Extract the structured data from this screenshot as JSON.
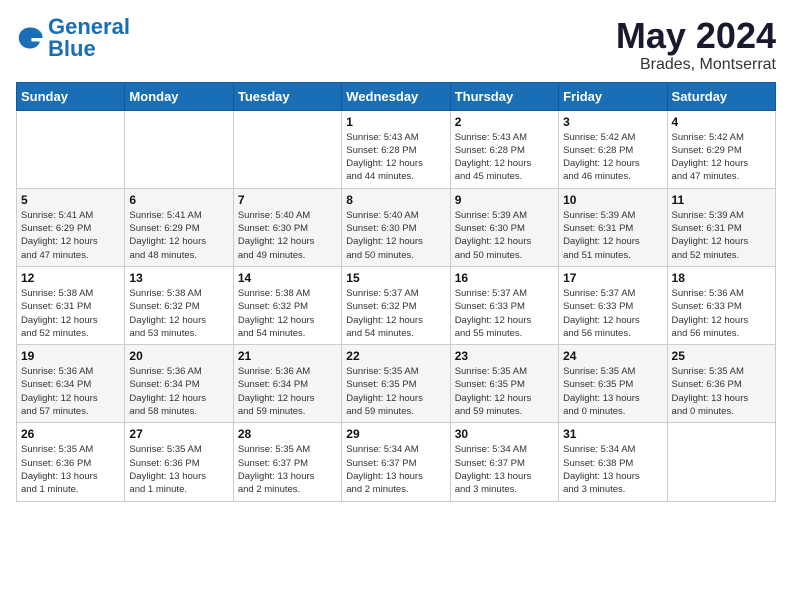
{
  "logo": {
    "line1": "General",
    "line2": "Blue"
  },
  "title": {
    "month": "May 2024",
    "location": "Brades, Montserrat"
  },
  "weekdays": [
    "Sunday",
    "Monday",
    "Tuesday",
    "Wednesday",
    "Thursday",
    "Friday",
    "Saturday"
  ],
  "weeks": [
    [
      {
        "day": "",
        "info": ""
      },
      {
        "day": "",
        "info": ""
      },
      {
        "day": "",
        "info": ""
      },
      {
        "day": "1",
        "info": "Sunrise: 5:43 AM\nSunset: 6:28 PM\nDaylight: 12 hours\nand 44 minutes."
      },
      {
        "day": "2",
        "info": "Sunrise: 5:43 AM\nSunset: 6:28 PM\nDaylight: 12 hours\nand 45 minutes."
      },
      {
        "day": "3",
        "info": "Sunrise: 5:42 AM\nSunset: 6:28 PM\nDaylight: 12 hours\nand 46 minutes."
      },
      {
        "day": "4",
        "info": "Sunrise: 5:42 AM\nSunset: 6:29 PM\nDaylight: 12 hours\nand 47 minutes."
      }
    ],
    [
      {
        "day": "5",
        "info": "Sunrise: 5:41 AM\nSunset: 6:29 PM\nDaylight: 12 hours\nand 47 minutes."
      },
      {
        "day": "6",
        "info": "Sunrise: 5:41 AM\nSunset: 6:29 PM\nDaylight: 12 hours\nand 48 minutes."
      },
      {
        "day": "7",
        "info": "Sunrise: 5:40 AM\nSunset: 6:30 PM\nDaylight: 12 hours\nand 49 minutes."
      },
      {
        "day": "8",
        "info": "Sunrise: 5:40 AM\nSunset: 6:30 PM\nDaylight: 12 hours\nand 50 minutes."
      },
      {
        "day": "9",
        "info": "Sunrise: 5:39 AM\nSunset: 6:30 PM\nDaylight: 12 hours\nand 50 minutes."
      },
      {
        "day": "10",
        "info": "Sunrise: 5:39 AM\nSunset: 6:31 PM\nDaylight: 12 hours\nand 51 minutes."
      },
      {
        "day": "11",
        "info": "Sunrise: 5:39 AM\nSunset: 6:31 PM\nDaylight: 12 hours\nand 52 minutes."
      }
    ],
    [
      {
        "day": "12",
        "info": "Sunrise: 5:38 AM\nSunset: 6:31 PM\nDaylight: 12 hours\nand 52 minutes."
      },
      {
        "day": "13",
        "info": "Sunrise: 5:38 AM\nSunset: 6:32 PM\nDaylight: 12 hours\nand 53 minutes."
      },
      {
        "day": "14",
        "info": "Sunrise: 5:38 AM\nSunset: 6:32 PM\nDaylight: 12 hours\nand 54 minutes."
      },
      {
        "day": "15",
        "info": "Sunrise: 5:37 AM\nSunset: 6:32 PM\nDaylight: 12 hours\nand 54 minutes."
      },
      {
        "day": "16",
        "info": "Sunrise: 5:37 AM\nSunset: 6:33 PM\nDaylight: 12 hours\nand 55 minutes."
      },
      {
        "day": "17",
        "info": "Sunrise: 5:37 AM\nSunset: 6:33 PM\nDaylight: 12 hours\nand 56 minutes."
      },
      {
        "day": "18",
        "info": "Sunrise: 5:36 AM\nSunset: 6:33 PM\nDaylight: 12 hours\nand 56 minutes."
      }
    ],
    [
      {
        "day": "19",
        "info": "Sunrise: 5:36 AM\nSunset: 6:34 PM\nDaylight: 12 hours\nand 57 minutes."
      },
      {
        "day": "20",
        "info": "Sunrise: 5:36 AM\nSunset: 6:34 PM\nDaylight: 12 hours\nand 58 minutes."
      },
      {
        "day": "21",
        "info": "Sunrise: 5:36 AM\nSunset: 6:34 PM\nDaylight: 12 hours\nand 59 minutes."
      },
      {
        "day": "22",
        "info": "Sunrise: 5:35 AM\nSunset: 6:35 PM\nDaylight: 12 hours\nand 59 minutes."
      },
      {
        "day": "23",
        "info": "Sunrise: 5:35 AM\nSunset: 6:35 PM\nDaylight: 12 hours\nand 59 minutes."
      },
      {
        "day": "24",
        "info": "Sunrise: 5:35 AM\nSunset: 6:35 PM\nDaylight: 13 hours\nand 0 minutes."
      },
      {
        "day": "25",
        "info": "Sunrise: 5:35 AM\nSunset: 6:36 PM\nDaylight: 13 hours\nand 0 minutes."
      }
    ],
    [
      {
        "day": "26",
        "info": "Sunrise: 5:35 AM\nSunset: 6:36 PM\nDaylight: 13 hours\nand 1 minute."
      },
      {
        "day": "27",
        "info": "Sunrise: 5:35 AM\nSunset: 6:36 PM\nDaylight: 13 hours\nand 1 minute."
      },
      {
        "day": "28",
        "info": "Sunrise: 5:35 AM\nSunset: 6:37 PM\nDaylight: 13 hours\nand 2 minutes."
      },
      {
        "day": "29",
        "info": "Sunrise: 5:34 AM\nSunset: 6:37 PM\nDaylight: 13 hours\nand 2 minutes."
      },
      {
        "day": "30",
        "info": "Sunrise: 5:34 AM\nSunset: 6:37 PM\nDaylight: 13 hours\nand 3 minutes."
      },
      {
        "day": "31",
        "info": "Sunrise: 5:34 AM\nSunset: 6:38 PM\nDaylight: 13 hours\nand 3 minutes."
      },
      {
        "day": "",
        "info": ""
      }
    ]
  ]
}
